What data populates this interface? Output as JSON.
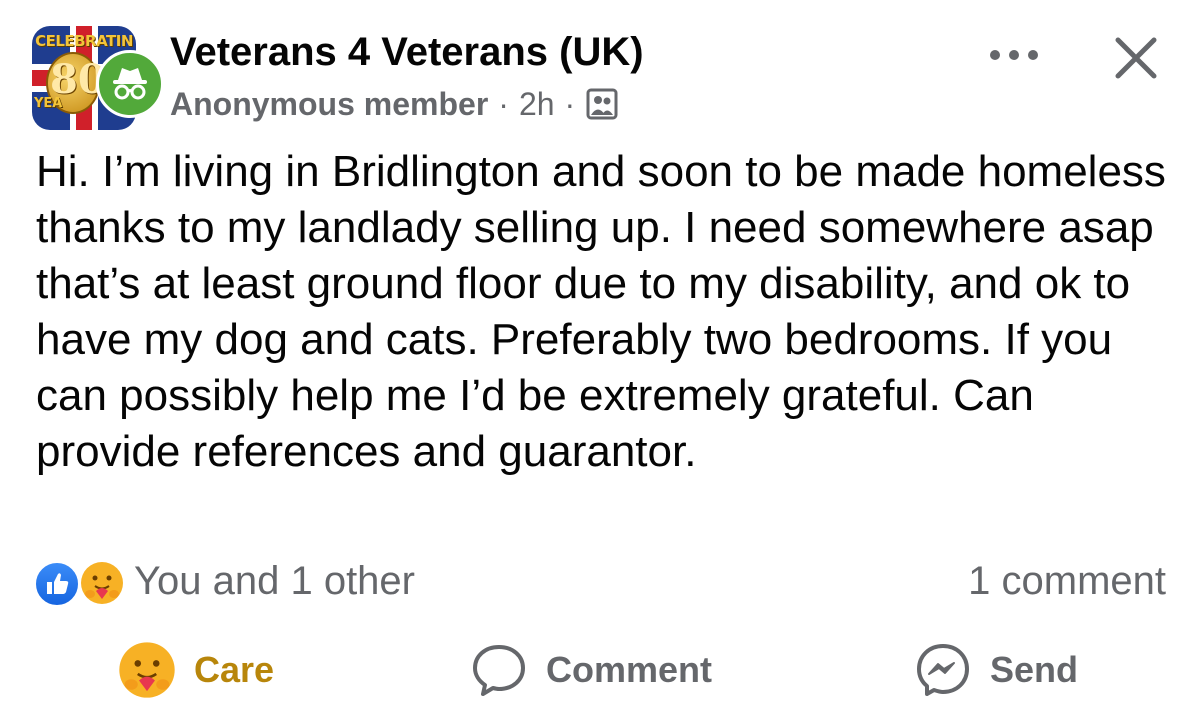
{
  "group": {
    "name": "Veterans 4 Veterans (UK)",
    "avatar_banner_top": "CELEBRATIN",
    "avatar_number": "80",
    "avatar_banner_bottom": "YEA"
  },
  "post": {
    "author": "Anonymous member",
    "separator": "·",
    "time": "2h",
    "privacy_icon": "group-members-icon",
    "text": "Hi. I’m living in Bridlington and soon to be made homeless thanks to my landlady selling up. I need somewhere asap that’s at least ground floor due to my disability, and ok to have my dog and cats. Preferably two bedrooms. If you can possibly help me I’d be extremely grateful. Can provide references and guarantor."
  },
  "reactions": {
    "summary": "You and 1 other",
    "comments": "1 comment"
  },
  "actions": {
    "care": "Care",
    "comment": "Comment",
    "send": "Send"
  },
  "colors": {
    "secondary_text": "#65676b",
    "care_accent": "#b8860b",
    "like_blue": "#1665e0",
    "anon_green": "#52a93a"
  }
}
